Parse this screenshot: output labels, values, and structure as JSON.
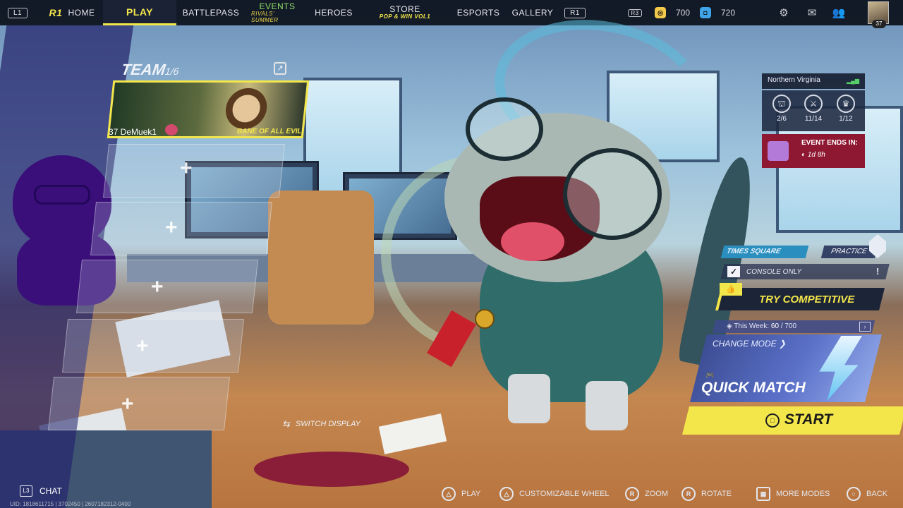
{
  "nav": {
    "left_bumper": "L1",
    "home_label": "HOME",
    "play_label": "PLAY",
    "battlepass_label": "BATTLEPASS",
    "events_label": "EVENTS",
    "events_sub": "RIVALS' SUMMER",
    "heroes_label": "HEROES",
    "store_label": "STORE",
    "store_sub": "POP & WIN VOL1",
    "esports_label": "ESPORTS",
    "gallery_label": "GALLERY",
    "right_bumper": "R1",
    "r3_badge": "R3",
    "currency_1": "700",
    "currency_2": "720",
    "profile_level": "37"
  },
  "team": {
    "title": "TEAM",
    "count": "1/6",
    "player": {
      "level_name": "37 DeMuek1",
      "tag": "BANE OF ALL EVIL"
    },
    "empty_slots": [
      "+",
      "+",
      "+",
      "+",
      "+"
    ],
    "switch_display": "SWITCH DISPLAY"
  },
  "server": {
    "region": "Northern Virginia"
  },
  "stats": [
    {
      "icon": "tower-icon",
      "glyph": "⛫",
      "value": "2/6"
    },
    {
      "icon": "crossed-swords-icon",
      "glyph": "⚔",
      "value": "11/14"
    },
    {
      "icon": "trophy-icon",
      "glyph": "♛",
      "value": "1/12"
    }
  ],
  "event": {
    "title": "EVENT ENDS IN:",
    "time": "1d 8h"
  },
  "match": {
    "map_name": "TIMES SQUARE",
    "practice_label": "PRACTICE",
    "console_only_label": "CONSOLE ONLY",
    "console_checked": true,
    "try_competitive_label": "TRY COMPETITIVE",
    "this_week_label": "This Week:",
    "this_week_value": "60",
    "this_week_max": "/ 700",
    "change_mode_label": "CHANGE MODE",
    "mode_name": "QUICK MATCH",
    "start_label": "START"
  },
  "hints": {
    "chat": "CHAT",
    "chat_key": "L3",
    "play": "PLAY",
    "customizable_wheel": "CUSTOMIZABLE WHEEL",
    "zoom": "ZOOM",
    "rotate": "ROTATE",
    "more_modes": "MORE MODES",
    "back": "BACK",
    "zoom_key": "R",
    "rotate_key": "R"
  },
  "uid_text": "UID: 1818611715 | 3702450 | 2607182312-0400",
  "colors": {
    "accent_yellow": "#f2e64a",
    "event_red": "#8e1732",
    "nav_bg": "#0c111c"
  }
}
